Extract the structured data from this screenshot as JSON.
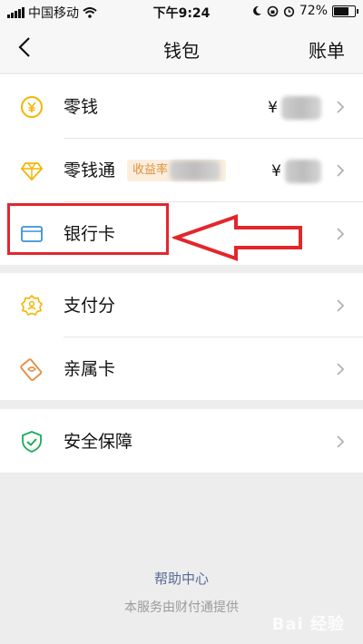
{
  "status_bar": {
    "carrier": "中国移动",
    "time": "下午9:24",
    "battery": "72%"
  },
  "header": {
    "title": "钱包",
    "right_action": "账单"
  },
  "items": [
    {
      "label": "零钱",
      "amount_prefix": "¥",
      "icon": "yen-coin-icon"
    },
    {
      "label": "零钱通",
      "badge": "收益率",
      "amount_prefix": "¥",
      "icon": "diamond-icon"
    },
    {
      "label": "银行卡",
      "icon": "bank-card-icon"
    },
    {
      "label": "支付分",
      "icon": "badge-score-icon"
    },
    {
      "label": "亲属卡",
      "icon": "family-card-icon"
    },
    {
      "label": "安全保障",
      "icon": "shield-check-icon"
    }
  ],
  "footer": {
    "help_link": "帮助中心",
    "note": "本服务由财付通提供"
  },
  "watermark": "Bai 经验",
  "colors": {
    "accent_yellow": "#f5b400",
    "accent_blue": "#3d90d8",
    "accent_orange": "#e68a3c",
    "accent_green": "#1aad5a",
    "annotation_red": "#e3262c",
    "link_blue": "#576b95"
  }
}
